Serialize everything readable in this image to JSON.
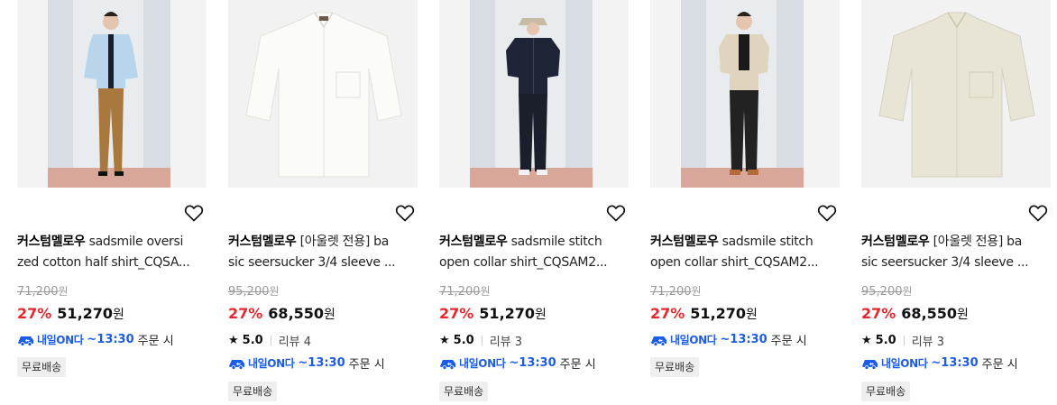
{
  "colors": {
    "sale": "#e8262d",
    "delivery": "#1c5de8"
  },
  "products": [
    {
      "brand": "커스텀멜로우",
      "title_line1": " sadsmile oversi",
      "title_line2": "zed cotton half shirt_CQSA...",
      "original_price": "71,200",
      "discount": "27%",
      "sale_price": "51,270",
      "currency": "원",
      "rating": null,
      "delivery_badge": "내일ON다",
      "delivery_time": "~13:30",
      "delivery_suffix": "주문 시",
      "shipping": "무료배송",
      "image": "model-light-blue-shirt"
    },
    {
      "brand": "커스텀멜로우",
      "title_line1": " [아울렛 전용] ba",
      "title_line2": "sic seersucker 3/4 sleeve ...",
      "original_price": "95,200",
      "discount": "27%",
      "sale_price": "68,550",
      "currency": "원",
      "rating": {
        "score": "5.0",
        "reviews": "리뷰 4"
      },
      "delivery_badge": "내일ON다",
      "delivery_time": "~13:30",
      "delivery_suffix": "주문 시",
      "shipping": "무료배송",
      "image": "flat-white-shirt"
    },
    {
      "brand": "커스텀멜로우",
      "title_line1": " sadsmile stitch",
      "title_line2": "open collar shirt_CQSAM2...",
      "original_price": "71,200",
      "discount": "27%",
      "sale_price": "51,270",
      "currency": "원",
      "rating": {
        "score": "5.0",
        "reviews": "리뷰 3"
      },
      "delivery_badge": "내일ON다",
      "delivery_time": "~13:30",
      "delivery_suffix": "주문 시",
      "shipping": "무료배송",
      "image": "model-navy-shirt"
    },
    {
      "brand": "커스텀멜로우",
      "title_line1": " sadsmile stitch",
      "title_line2": "open collar shirt_CQSAM2...",
      "original_price": "71,200",
      "discount": "27%",
      "sale_price": "51,270",
      "currency": "원",
      "rating": null,
      "delivery_badge": "내일ON다",
      "delivery_time": "~13:30",
      "delivery_suffix": "주문 시",
      "shipping": "무료배송",
      "image": "model-beige-shirt"
    },
    {
      "brand": "커스텀멜로우",
      "title_line1": " [아울렛 전용] ba",
      "title_line2": "sic seersucker 3/4 sleeve ...",
      "original_price": "95,200",
      "discount": "27%",
      "sale_price": "68,550",
      "currency": "원",
      "rating": {
        "score": "5.0",
        "reviews": "리뷰 3"
      },
      "delivery_badge": "내일ON다",
      "delivery_time": "~13:30",
      "delivery_suffix": "주문 시",
      "shipping": "무료배송",
      "image": "flat-beige-shirt"
    }
  ]
}
